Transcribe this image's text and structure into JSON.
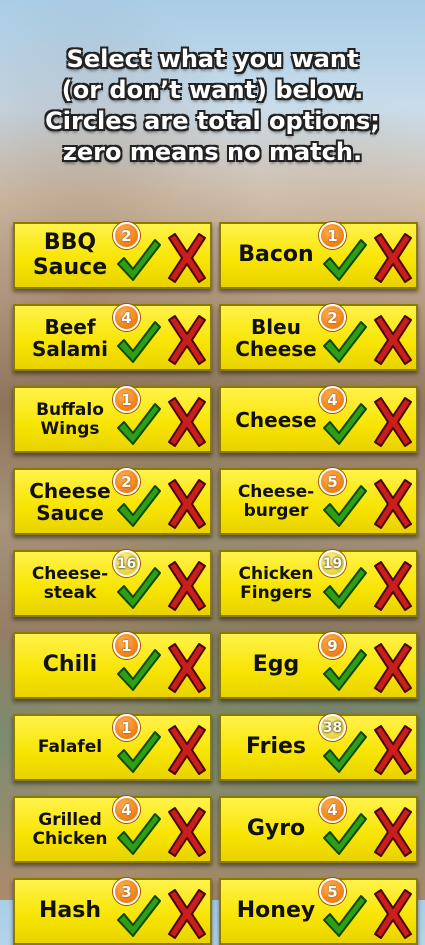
{
  "instructions": [
    "Select what you want",
    "(or don’t want) below.",
    "Circles are total options;",
    "zero means no match."
  ],
  "colors": {
    "card": "#f7e400",
    "check": "#2e9e1a",
    "x": "#c81e1e",
    "badge": "#f07d10"
  },
  "options": [
    {
      "lines": [
        "BBQ",
        "Sauce"
      ],
      "count": "2"
    },
    {
      "lines": [
        "Bacon"
      ],
      "count": "1"
    },
    {
      "lines": [
        "Beef",
        "Salami"
      ],
      "count": "4"
    },
    {
      "lines": [
        "Bleu",
        "Cheese"
      ],
      "count": "2"
    },
    {
      "lines": [
        "Buffalo",
        "Wings"
      ],
      "count": "1"
    },
    {
      "lines": [
        "Cheese"
      ],
      "count": "4"
    },
    {
      "lines": [
        "Cheese",
        "Sauce"
      ],
      "count": "2"
    },
    {
      "lines": [
        "Cheese-",
        "burger"
      ],
      "count": "5"
    },
    {
      "lines": [
        "Cheese-",
        "steak"
      ],
      "count": "16"
    },
    {
      "lines": [
        "Chicken",
        "Fingers"
      ],
      "count": "19"
    },
    {
      "lines": [
        "Chili"
      ],
      "count": "1"
    },
    {
      "lines": [
        "Egg"
      ],
      "count": "9"
    },
    {
      "lines": [
        "Falafel"
      ],
      "count": "1"
    },
    {
      "lines": [
        "Fries"
      ],
      "count": "38"
    },
    {
      "lines": [
        "Grilled",
        "Chicken"
      ],
      "count": "4"
    },
    {
      "lines": [
        "Gyro"
      ],
      "count": "4"
    },
    {
      "lines": [
        "Hash"
      ],
      "count": "3"
    },
    {
      "lines": [
        "Honey"
      ],
      "count": "5"
    }
  ]
}
